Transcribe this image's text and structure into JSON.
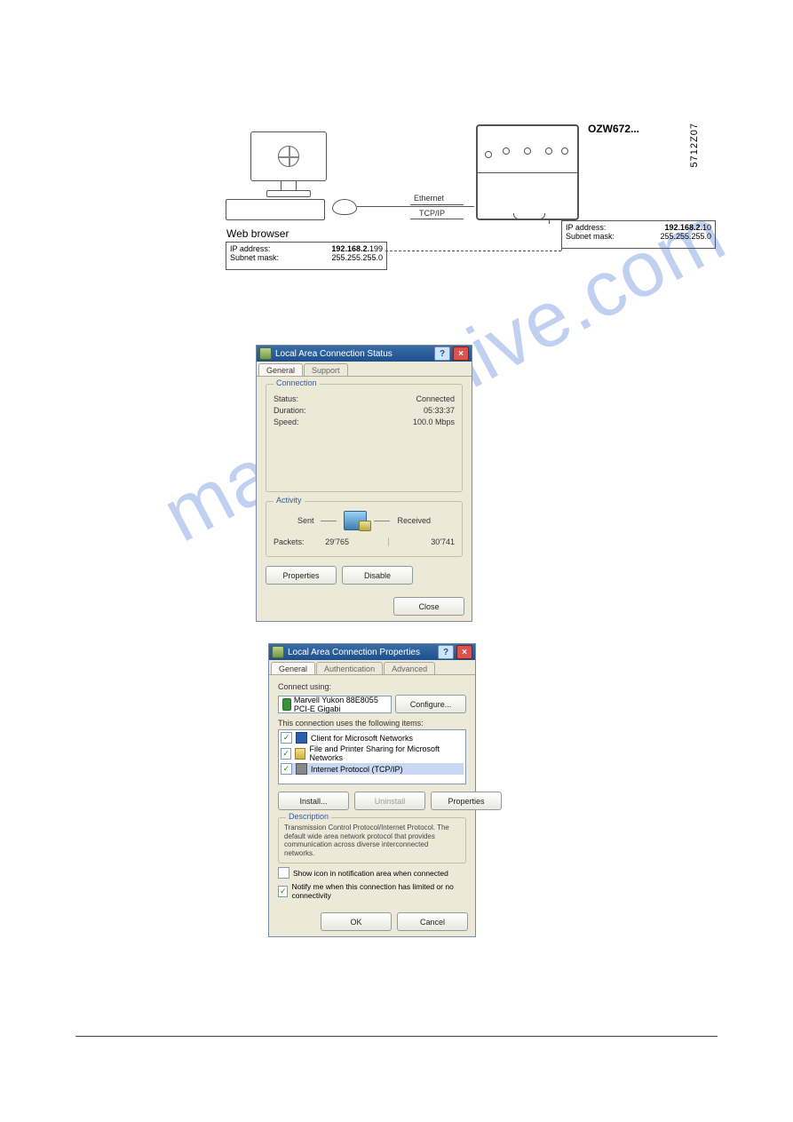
{
  "diagram": {
    "device_label": "OZW672...",
    "side_code": "5712Z07",
    "conn_line1": "Ethernet",
    "conn_line2": "TCP/IP",
    "pc_label": "Web browser",
    "pc_box": {
      "l1": "IP address:",
      "v1": "192.168.2.",
      "v1b": "199",
      "l2": "Subnet mask:",
      "v2": "255.255.255.0"
    },
    "dev_box": {
      "l1": "IP address:",
      "v1": "192.168.2.",
      "v1b": "10",
      "l2": "Subnet mask:",
      "v2": "255.255.255.0"
    }
  },
  "dlg1": {
    "title": "Local Area Connection Status",
    "tabs": [
      "General",
      "Support"
    ],
    "group_conn": "Connection",
    "rows_conn": [
      {
        "l": "Status:",
        "v": "Connected"
      },
      {
        "l": "Duration:",
        "v": "05:33:37"
      },
      {
        "l": "Speed:",
        "v": "100.0 Mbps"
      }
    ],
    "group_act": "Activity",
    "sent": "Sent",
    "received": "Received",
    "packets_label": "Packets:",
    "packets_sent": "29'765",
    "packets_recv": "30'741",
    "btn_props": "Properties",
    "btn_disable": "Disable",
    "btn_close": "Close"
  },
  "dlg2": {
    "title": "Local Area Connection Properties",
    "tabs": [
      "General",
      "Authentication",
      "Advanced"
    ],
    "connect_using": "Connect using:",
    "adapter": "Marvell Yukon 88E8055 PCI-E Gigabi",
    "btn_configure": "Configure...",
    "uses_items": "This connection uses the following items:",
    "items": [
      "Client for Microsoft Networks",
      "File and Printer Sharing for Microsoft Networks",
      "Internet Protocol (TCP/IP)"
    ],
    "btn_install": "Install...",
    "btn_uninstall": "Uninstall",
    "btn_properties": "Properties",
    "desc_legend": "Description",
    "desc_text": "Transmission Control Protocol/Internet Protocol. The default wide area network protocol that provides communication across diverse interconnected networks.",
    "cb_showicon": "Show icon in notification area when connected",
    "cb_notify": "Notify me when this connection has limited or no connectivity",
    "btn_ok": "OK",
    "btn_cancel": "Cancel"
  },
  "watermark": "manualshive.com"
}
